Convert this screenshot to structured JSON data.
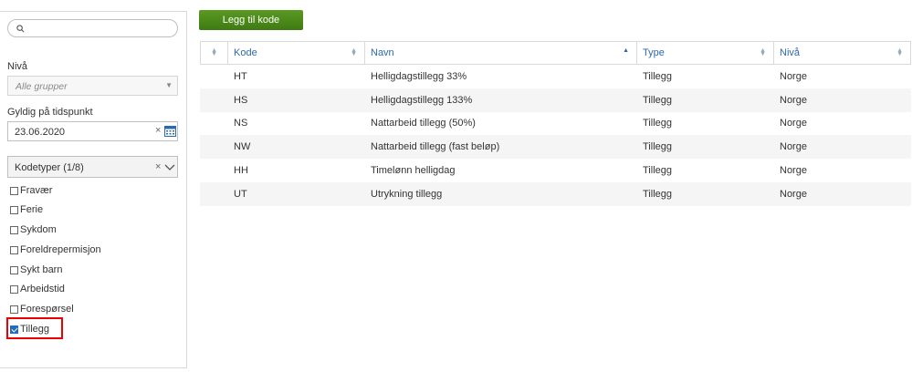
{
  "sidebar": {
    "search_placeholder": "",
    "level_label": "Nivå",
    "level_placeholder": "Alle grupper",
    "valid_label": "Gyldig på tidspunkt",
    "date_value": "23.06.2020",
    "codetypes_label": "Kodetyper (1/8)",
    "checkboxes": [
      {
        "label": "Fravær",
        "checked": false
      },
      {
        "label": "Ferie",
        "checked": false
      },
      {
        "label": "Sykdom",
        "checked": false
      },
      {
        "label": "Foreldrepermisjon",
        "checked": false
      },
      {
        "label": "Sykt barn",
        "checked": false
      },
      {
        "label": "Arbeidstid",
        "checked": false
      },
      {
        "label": "Forespørsel",
        "checked": false
      },
      {
        "label": "Tillegg",
        "checked": true
      }
    ]
  },
  "toolbar": {
    "add_label": "Legg til kode"
  },
  "table": {
    "columns": [
      "Kode",
      "Navn",
      "Type",
      "Nivå"
    ],
    "sorted_column": "Navn",
    "rows": [
      [
        "HT",
        "Helligdagstillegg 33%",
        "Tillegg",
        "Norge"
      ],
      [
        "HS",
        "Helligdagstillegg 133%",
        "Tillegg",
        "Norge"
      ],
      [
        "NS",
        "Nattarbeid tillegg (50%)",
        "Tillegg",
        "Norge"
      ],
      [
        "NW",
        "Nattarbeid tillegg (fast beløp)",
        "Tillegg",
        "Norge"
      ],
      [
        "HH",
        "Timelønn helligdag",
        "Tillegg",
        "Norge"
      ],
      [
        "UT",
        "Utrykning tillegg",
        "Tillegg",
        "Norge"
      ]
    ]
  },
  "icons": {
    "search": "search-icon",
    "calendar": "calendar-icon",
    "clear": "×",
    "chevron": "chevron-down-icon",
    "sort": "sort-icon"
  },
  "colors": {
    "accent_green": "#4f8c1c",
    "link_blue": "#2c6aa8",
    "highlight_red": "#e00000"
  }
}
